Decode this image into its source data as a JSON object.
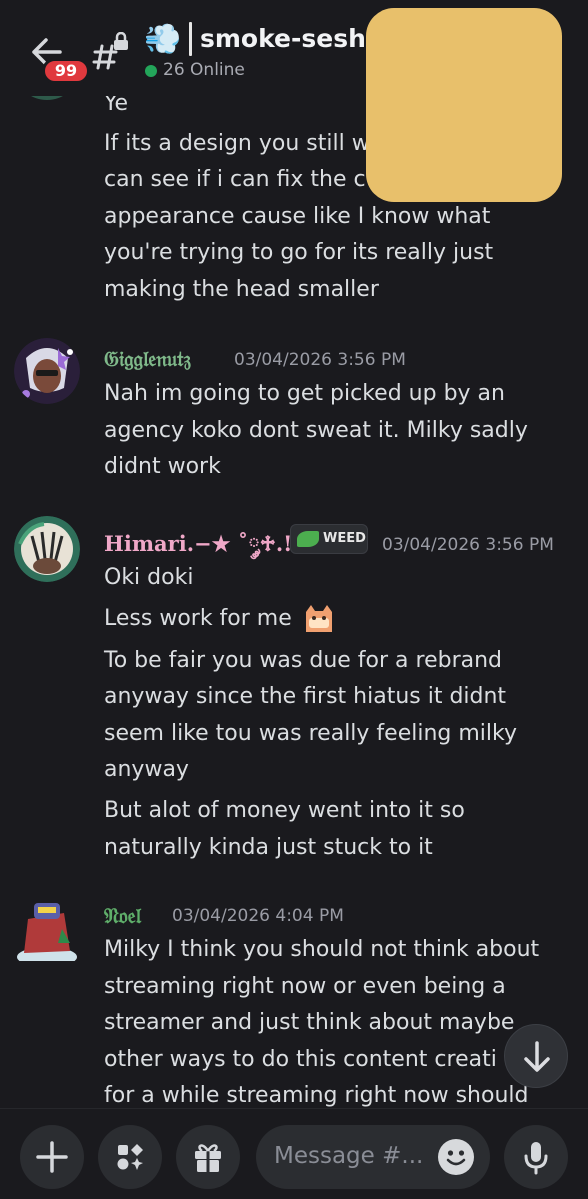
{
  "header": {
    "unread_badge": "99",
    "channel_emoji": "💨",
    "channel_name": "smoke-sesh",
    "online_text": "26 Online"
  },
  "colors": {
    "background": "#1a1a1e",
    "online_green": "#23a55a",
    "badge_red": "#e0393e",
    "gigglenutz_name": "#7fb98a",
    "himari_name": "#f0a8c8",
    "noel_name": "#5fae6a"
  },
  "messages": [
    {
      "author": "",
      "timestamp": "",
      "lines": [
        "Ye",
        "If its a design you still w",
        "can see if i can fix the c",
        "appearance cause like I know what",
        "you're trying to go for its really just",
        "making the head smaller"
      ]
    },
    {
      "author": "𝔊𝔦𝔤𝔤𝔩𝔢𝔫𝔲𝔱𝔷",
      "timestamp": "03/04/2026 3:56 PM",
      "lines": [
        "Nah im going to get picked up by an",
        "agency koko dont sweat it. Milky sadly",
        "didnt work"
      ]
    },
    {
      "author": "Himari.−★ ˚༘♱.!!",
      "tag": "WEED",
      "timestamp": "03/04/2026 3:56 PM",
      "lines": [
        "Oki doki",
        "Less work for me",
        "To be fair you was due for a rebrand",
        "anyway since the first hiatus it didnt",
        "seem like tou was really feeling milky",
        "anyway",
        "But alot of money went into it so",
        "naturally kinda just stuck to it"
      ]
    },
    {
      "author": "𝔑𝔬𝔢𝔩",
      "timestamp": "03/04/2026 4:04 PM",
      "lines": [
        "Milky I think you should not think about",
        "streaming right now or even being a",
        "streamer and just think about maybe",
        "other ways to do this content creati",
        "for a while streaming right now should"
      ]
    }
  ],
  "composer": {
    "placeholder": "Message #..."
  },
  "icons": [
    "back-arrow-icon",
    "hash-lock-icon",
    "plus-icon",
    "apps-icon",
    "gift-icon",
    "emoji-icon",
    "microphone-icon",
    "arrow-down-icon"
  ]
}
